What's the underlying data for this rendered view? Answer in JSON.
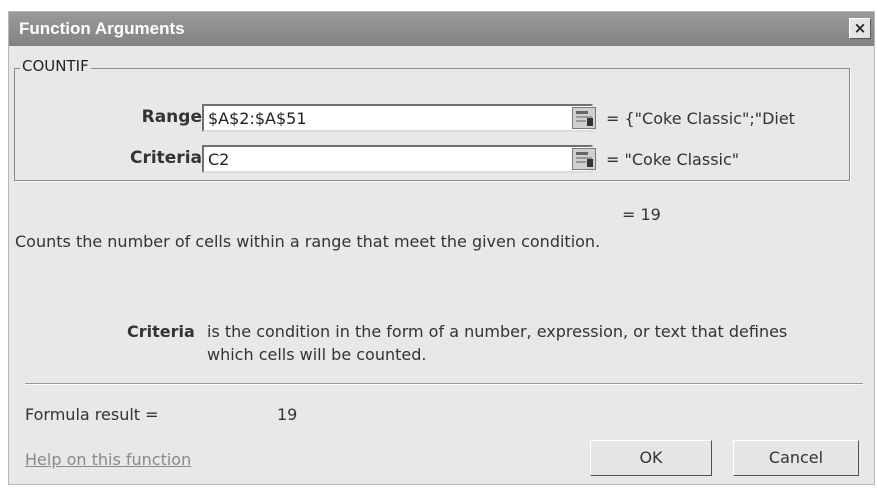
{
  "dialog": {
    "title": "Function Arguments",
    "close_glyph": "×"
  },
  "function_group": {
    "name": "COUNTIF",
    "arguments": [
      {
        "label": "Range",
        "value": "$A$2:$A$51",
        "evaluated": "= {\"Coke Classic\";\"Diet"
      },
      {
        "label": "Criteria",
        "value": "C2",
        "evaluated": "= \"Coke Classic\""
      }
    ]
  },
  "result_preview": "= 19",
  "description": "Counts the number of cells within a range that meet the given condition.",
  "arg_help": {
    "name": "Criteria",
    "line1": "is the condition in the form of a number, expression, or text that defines",
    "line2": "which cells will be counted."
  },
  "formula_result": {
    "label": "Formula result =",
    "value": "19"
  },
  "help_link": "Help on this function",
  "buttons": {
    "ok": "OK",
    "cancel": "Cancel"
  },
  "icons": {
    "collapse": "collapse-dialog-icon",
    "close": "close-icon"
  },
  "colors": {
    "titlebar": "#8c8c8c",
    "dialog_bg": "#e8e8e8"
  }
}
